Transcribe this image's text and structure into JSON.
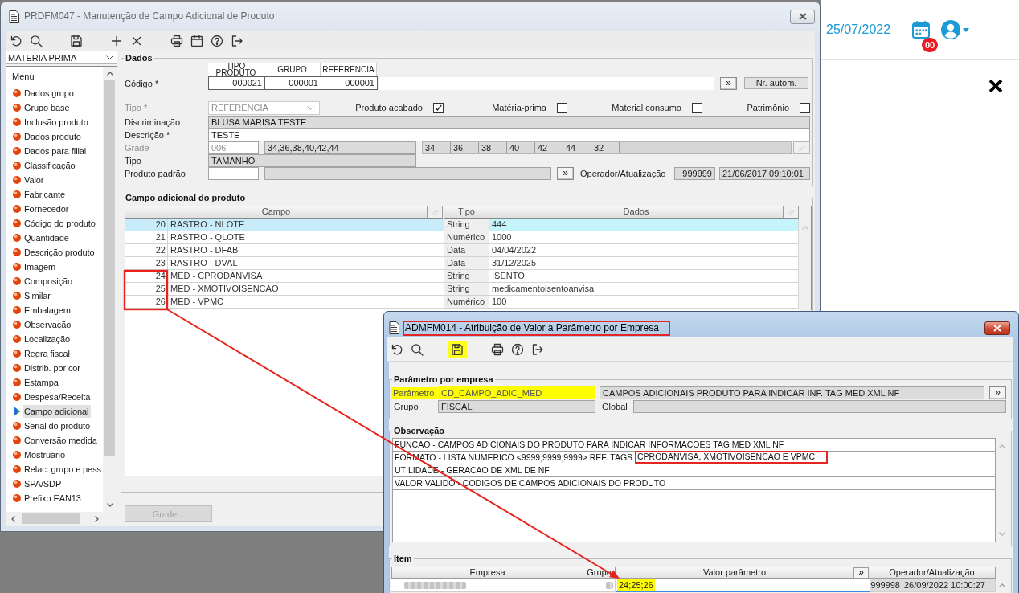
{
  "background_page": {
    "date": "25/07/2022",
    "notification_count": "00"
  },
  "main_window": {
    "title": "PRDFM047 - Manutenção de Campo Adicional de Produto",
    "active": false,
    "toolbar": [
      [
        {
          "kind": "undo"
        },
        {
          "kind": "search"
        }
      ],
      [
        {
          "kind": "save"
        }
      ],
      [
        {
          "kind": "add"
        },
        {
          "kind": "delete"
        }
      ],
      [
        {
          "kind": "print"
        },
        {
          "kind": "calendar"
        },
        {
          "kind": "help"
        },
        {
          "kind": "exit"
        }
      ]
    ],
    "category_select": {
      "value": "MATERIA PRIMA"
    },
    "menu": {
      "title": "Menu",
      "items": [
        {
          "label": "Dados grupo",
          "selected": false
        },
        {
          "label": "Grupo base",
          "selected": false
        },
        {
          "label": "Inclusão produto",
          "selected": false
        },
        {
          "label": "Dados produto",
          "selected": false
        },
        {
          "label": "Dados para filial",
          "selected": false
        },
        {
          "label": "Classificação",
          "selected": false
        },
        {
          "label": "Valor",
          "selected": false
        },
        {
          "label": "Fabricante",
          "selected": false
        },
        {
          "label": "Fornecedor",
          "selected": false
        },
        {
          "label": "Código do produto",
          "selected": false
        },
        {
          "label": "Quantidade",
          "selected": false
        },
        {
          "label": "Descrição produto",
          "selected": false
        },
        {
          "label": "Imagem",
          "selected": false
        },
        {
          "label": "Composição",
          "selected": false
        },
        {
          "label": "Similar",
          "selected": false
        },
        {
          "label": "Embalagem",
          "selected": false
        },
        {
          "label": "Observação",
          "selected": false
        },
        {
          "label": "Localização",
          "selected": false
        },
        {
          "label": "Regra fiscal",
          "selected": false
        },
        {
          "label": "Distrib. por cor",
          "selected": false
        },
        {
          "label": "Estampa",
          "selected": false
        },
        {
          "label": "Despesa/Receita",
          "selected": false
        },
        {
          "label": "Campo adicional",
          "selected": true
        },
        {
          "label": "Serial do produto",
          "selected": false
        },
        {
          "label": "Conversão medida",
          "selected": false
        },
        {
          "label": "Mostruário",
          "selected": false
        },
        {
          "label": "Relac. grupo e pess",
          "selected": false
        },
        {
          "label": "SPA/SDP",
          "selected": false
        },
        {
          "label": "Prefixo EAN13",
          "selected": false
        }
      ]
    },
    "dados": {
      "legend": "Dados",
      "codigo": {
        "label": "Código *",
        "parts": [
          {
            "header": "TIPO PRODUTO",
            "value": "000021"
          },
          {
            "header": "GRUPO",
            "value": "000001"
          },
          {
            "header": "REFERENCIA",
            "value": "000001"
          }
        ],
        "lookup_button": "»",
        "auto_number_button": "Nr. autom."
      },
      "tipo": {
        "label": "Tipo *",
        "value": "REFERENCIA",
        "disabled": true
      },
      "flags": [
        {
          "label": "Produto acabado",
          "checked": true
        },
        {
          "label": "Matéria-prima",
          "checked": false
        },
        {
          "label": "Material consumo",
          "checked": false
        },
        {
          "label": "Patrimônio",
          "checked": false
        }
      ],
      "discriminacao": {
        "label": "Discriminação",
        "value": "BLUSA MARISA TESTE",
        "readonly": true
      },
      "descricao": {
        "label": "Descrição *",
        "value": "TESTE",
        "readonly": false
      },
      "grade": {
        "label": "Grade",
        "disabled": true,
        "code": "006",
        "sizes_list": "34,36,38,40,42,44",
        "sizes": [
          "34",
          "36",
          "38",
          "40",
          "42",
          "44",
          "32"
        ]
      },
      "tipo_grade": {
        "label": "Tipo",
        "value": "TAMANHO",
        "readonly": true
      },
      "produto_padrao": {
        "label": "Produto padrão",
        "lookup_button": "»"
      },
      "operador": {
        "label": "Operador/Atualização",
        "operator": "999999",
        "updated_at": "21/06/2017 09:10:01"
      }
    },
    "campo_adicional": {
      "legend": "Campo adicional do produto",
      "columns": [
        {
          "label": "Campo",
          "options_button": true
        },
        {
          "label": "Tipo",
          "options_button": false
        },
        {
          "label": "Dados",
          "options_button": true
        }
      ],
      "rows": [
        {
          "number": "20",
          "campo": "RASTRO - NLOTE",
          "tipo": "String",
          "dados": "444",
          "selected": true
        },
        {
          "number": "21",
          "campo": "RASTRO - QLOTE",
          "tipo": "Numérico",
          "dados": "1000",
          "selected": false
        },
        {
          "number": "22",
          "campo": "RASTRO - DFAB",
          "tipo": "Data",
          "dados": "04/04/2022",
          "selected": false
        },
        {
          "number": "23",
          "campo": "RASTRO - DVAL",
          "tipo": "Data",
          "dados": "31/12/2025",
          "selected": false
        },
        {
          "number": "24",
          "campo": "MED - CPRODANVISA",
          "tipo": "String",
          "dados": "ISENTO",
          "selected": false
        },
        {
          "number": "25",
          "campo": "MED - XMOTIVOISENCAO",
          "tipo": "String",
          "dados": "medicamentoisentoanvisa",
          "selected": false
        },
        {
          "number": "26",
          "campo": "MED - VPMC",
          "tipo": "Numérico",
          "dados": "100",
          "selected": false
        }
      ],
      "grade_button": {
        "label": "Grade...",
        "disabled": true
      }
    }
  },
  "parameter_window": {
    "title": "ADMFM014 - Atribuição de Valor a Parâmetro por Empresa",
    "title_marked": true,
    "active": true,
    "toolbar": [
      [
        {
          "kind": "undo",
          "highlighted": false
        },
        {
          "kind": "search",
          "highlighted": false
        }
      ],
      [
        {
          "kind": "save",
          "highlighted": true
        }
      ],
      [
        {
          "kind": "print",
          "highlighted": false
        },
        {
          "kind": "help",
          "highlighted": false
        },
        {
          "kind": "exit",
          "highlighted": false
        }
      ]
    ],
    "parametro_por_empresa": {
      "legend": "Parâmetro por empresa",
      "parametro": {
        "label": "Parâmetro",
        "value": "CD_CAMPO_ADIC_MED",
        "description": "CAMPOS ADICIONAIS PRODUTO PARA INDICAR INF. TAG MED XML NF",
        "highlighted": true
      },
      "lookup_button": "»",
      "grupo": {
        "label": "Grupo",
        "value": "FISCAL"
      },
      "global": {
        "label": "Global"
      }
    },
    "observacao": {
      "legend": "Observação",
      "lines": [
        {
          "text": "FUNCAO - CAMPOS ADICIONAIS DO PRODUTO PARA INDICAR INFORMACOES TAG MED XML NF"
        },
        {
          "text": "FORMATO - LISTA NUMERICO <9999;9999;9999> REF. TAGS ",
          "marked_text": "CPRODANVISA, XMOTIVOISENCAO E VPMC"
        },
        {
          "text": "UTILIDADE - GERACAO DE XML DE NF"
        },
        {
          "text": "VALOR VALIDO - CODIGOS DE CAMPOS ADICIONAIS DO PRODUTO"
        }
      ]
    },
    "item": {
      "legend": "Item",
      "columns": [
        {
          "label": "Empresa",
          "kind": "text"
        },
        {
          "label": "Grupo",
          "kind": "text"
        },
        {
          "label": "Valor parâmetro",
          "kind": "text"
        },
        {
          "label": "»",
          "kind": "button"
        },
        {
          "label": "Operador/Atualização",
          "kind": "text"
        }
      ],
      "rows": [
        {
          "valor_parametro": "24;25;26",
          "highlighted": true,
          "selected": true,
          "operador": "999998",
          "updated_at": "26/09/2022 10:00:27"
        }
      ]
    }
  }
}
